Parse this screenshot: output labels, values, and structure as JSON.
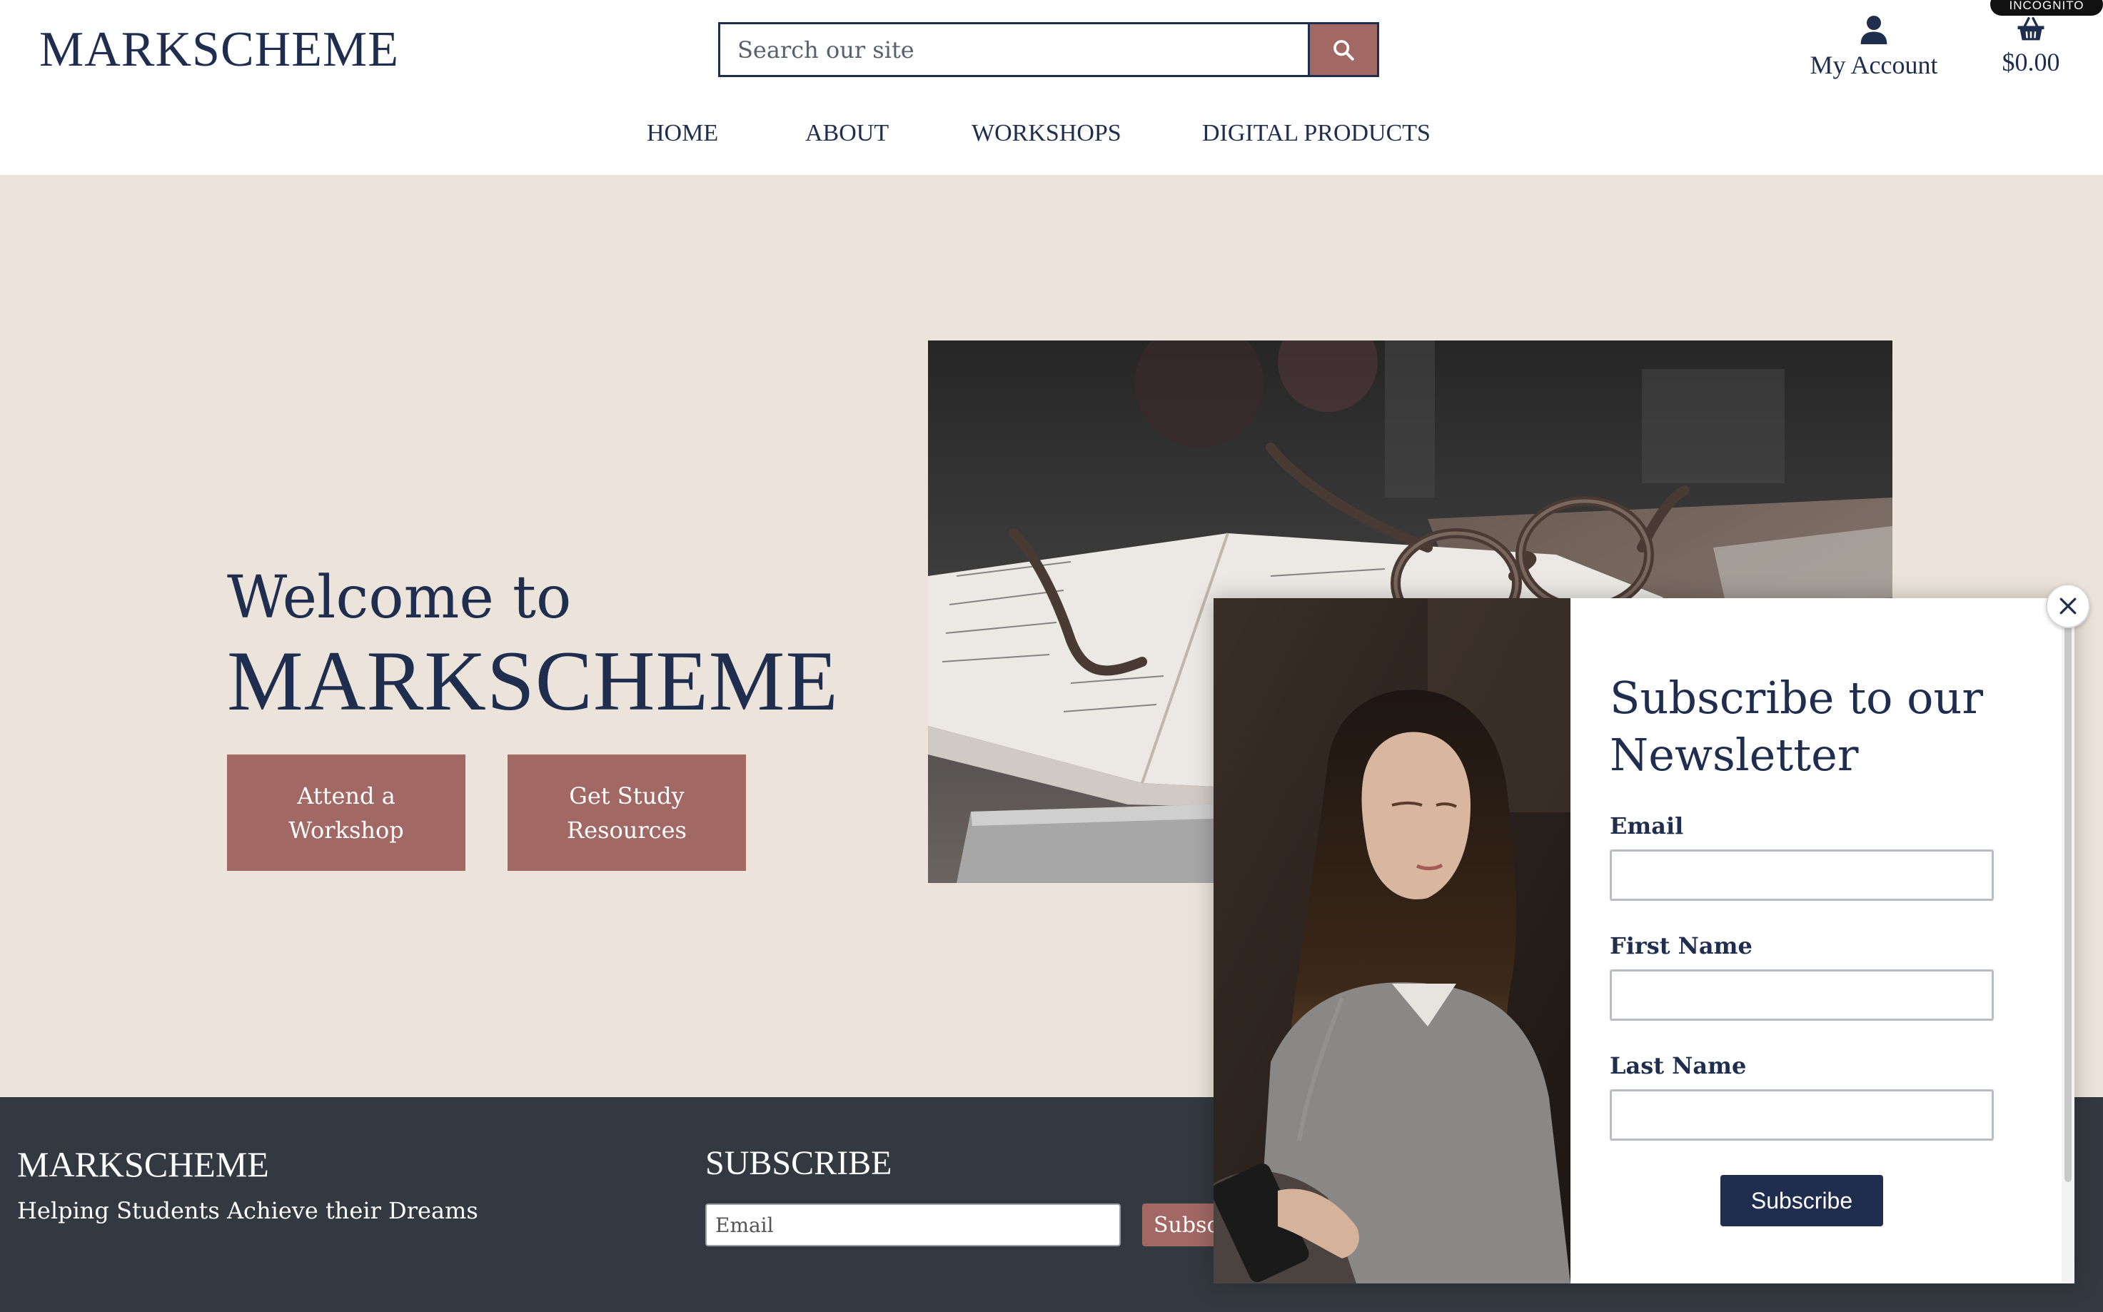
{
  "header": {
    "logo": "MARKSCHEME",
    "search": {
      "placeholder": "Search our site",
      "icon": "search-icon"
    },
    "account": {
      "label": "My Account",
      "icon": "user-icon"
    },
    "cart": {
      "total": "$0.00",
      "icon": "basket-icon"
    },
    "incognito_badge": "INCOGNITO"
  },
  "nav": {
    "items": [
      {
        "label": "HOME"
      },
      {
        "label": "ABOUT"
      },
      {
        "label": "WORKSHOPS"
      },
      {
        "label": "DIGITAL PRODUCTS"
      }
    ]
  },
  "hero": {
    "welcome_small": "Welcome to",
    "welcome_big": "MARKSCHEME",
    "buttons": [
      {
        "label": "Attend a Workshop"
      },
      {
        "label": "Get Study Resources"
      }
    ]
  },
  "footer": {
    "logo": "MARKSCHEME",
    "tagline": "Helping Students Achieve their Dreams",
    "subscribe_title": "SUBSCRIBE",
    "email_placeholder": "Email",
    "subscribe_button": "Subscribe"
  },
  "popup": {
    "title": "Subscribe to our Newsletter",
    "fields": [
      {
        "label": "Email"
      },
      {
        "label": "First Name"
      },
      {
        "label": "Last Name"
      }
    ],
    "submit": "Subscribe",
    "close_icon": "close-icon"
  },
  "colors": {
    "navy": "#1f2d4e",
    "rose": "#a26863",
    "hero_bg": "#ece4da",
    "footer_bg": "#333940"
  }
}
